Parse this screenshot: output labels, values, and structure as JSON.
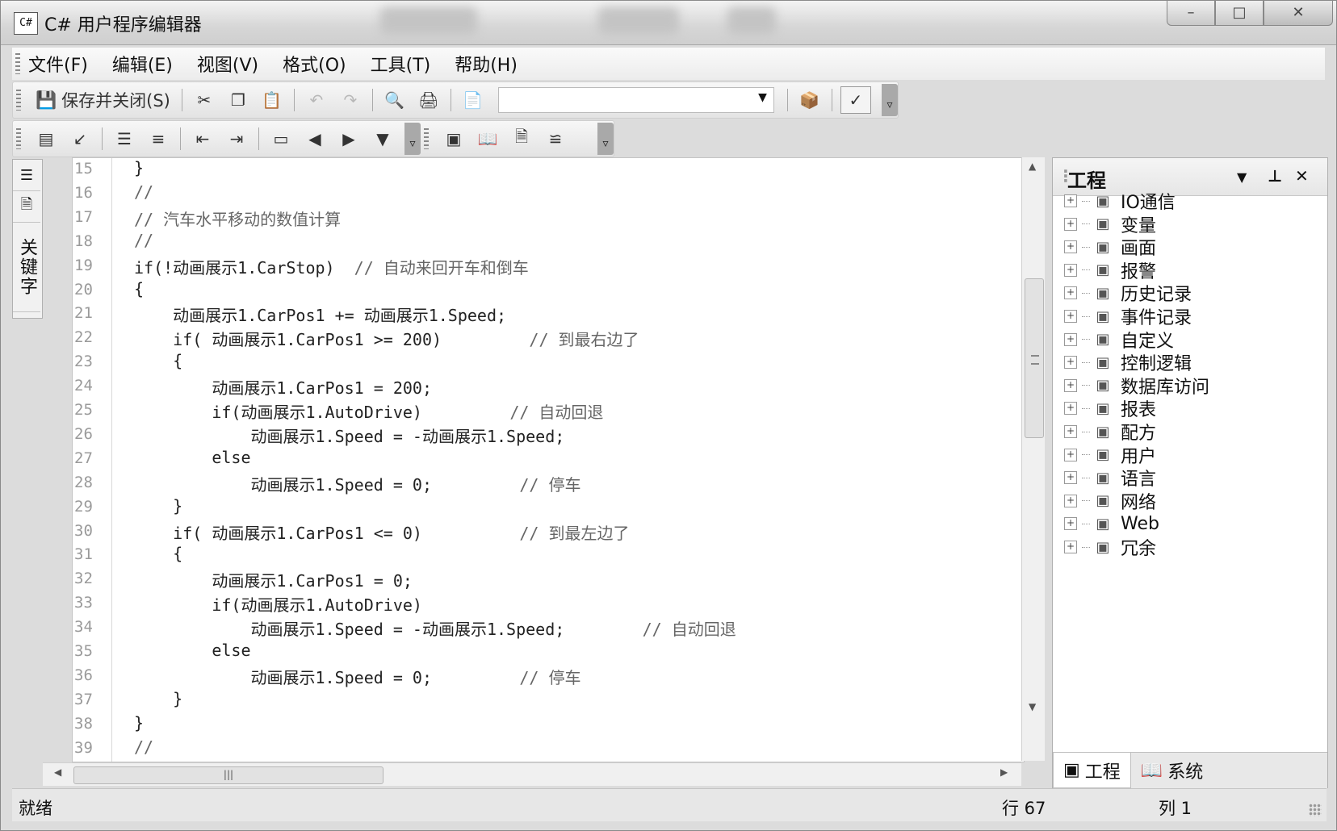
{
  "window": {
    "title": "C# 用户程序编辑器",
    "app_icon": "C#"
  },
  "menu": [
    "文件(F)",
    "编辑(E)",
    "视图(V)",
    "格式(O)",
    "工具(T)",
    "帮助(H)"
  ],
  "toolbar": {
    "save_close_label": "保存并关闭(S)",
    "combo_value": ""
  },
  "side_tabs": {
    "keywords_label": "关键字"
  },
  "editor": {
    "line_numbers": [
      "15",
      "16",
      "17",
      "18",
      "19",
      "20",
      "21",
      "22",
      "23",
      "24",
      "25",
      "26",
      "27",
      "28",
      "29",
      "30",
      "31",
      "32",
      "33",
      "34",
      "35",
      "36",
      "37",
      "38",
      "39"
    ],
    "lines": [
      "}",
      "//",
      "// 汽车水平移动的数值计算",
      "//",
      "if(!动画展示1.CarStop)  // 自动来回开车和倒车",
      "{",
      "    动画展示1.CarPos1 += 动画展示1.Speed;",
      "    if( 动画展示1.CarPos1 >= 200)         // 到最右边了",
      "    {",
      "        动画展示1.CarPos1 = 200;",
      "        if(动画展示1.AutoDrive)         // 自动回退",
      "            动画展示1.Speed = -动画展示1.Speed;",
      "        else",
      "            动画展示1.Speed = 0;         // 停车",
      "    }",
      "    if( 动画展示1.CarPos1 <= 0)          // 到最左边了",
      "    {",
      "        动画展示1.CarPos1 = 0;",
      "        if(动画展示1.AutoDrive)",
      "            动画展示1.Speed = -动画展示1.Speed;        // 自动回退",
      "        else",
      "            动画展示1.Speed = 0;         // 停车",
      "    }",
      "}",
      "//"
    ]
  },
  "project_panel": {
    "title": "工程",
    "items": [
      {
        "label": "IO通信",
        "icon": "network-icon"
      },
      {
        "label": "变量",
        "icon": "variable-icon"
      },
      {
        "label": "画面",
        "icon": "screen-icon"
      },
      {
        "label": "报警",
        "icon": "alarm-icon"
      },
      {
        "label": "历史记录",
        "icon": "history-icon"
      },
      {
        "label": "事件记录",
        "icon": "event-icon"
      },
      {
        "label": "自定义",
        "icon": "custom-icon"
      },
      {
        "label": "控制逻辑",
        "icon": "logic-icon"
      },
      {
        "label": "数据库访问",
        "icon": "database-icon"
      },
      {
        "label": "报表",
        "icon": "report-icon"
      },
      {
        "label": "配方",
        "icon": "recipe-icon"
      },
      {
        "label": "用户",
        "icon": "user-icon"
      },
      {
        "label": "语言",
        "icon": "language-icon"
      },
      {
        "label": "网络",
        "icon": "lan-icon"
      },
      {
        "label": "Web",
        "icon": "globe-icon"
      },
      {
        "label": "冗余",
        "icon": "redundancy-icon"
      }
    ],
    "tabs": [
      "工程",
      "系统"
    ]
  },
  "status": {
    "text": "就绪",
    "row": "行 67",
    "col": "列 1"
  }
}
